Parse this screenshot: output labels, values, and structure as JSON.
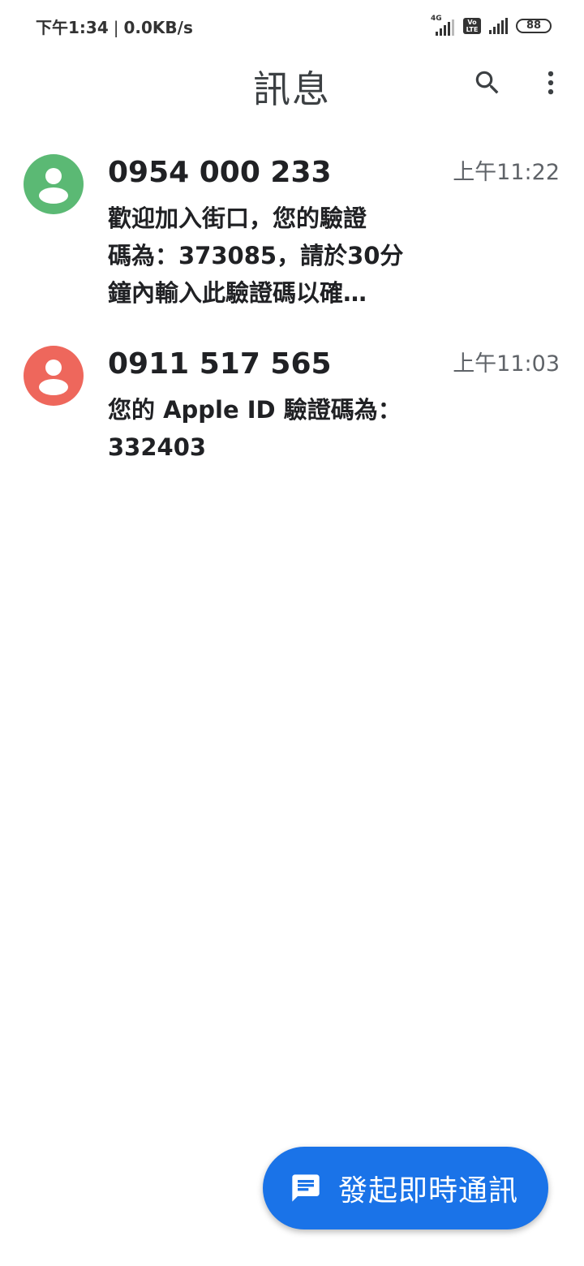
{
  "status_bar": {
    "time": "下午1:34",
    "network_speed": "0.0KB/s",
    "network_type": "4G",
    "volte": "Vo LTE",
    "battery": "88"
  },
  "app_bar": {
    "title": "訊息",
    "search_icon": "search-icon",
    "more_icon": "more-vert-icon"
  },
  "conversations": [
    {
      "sender": "0954 000 233",
      "time": "上午11:22",
      "avatar_color": "#5bb974",
      "snippet_lines": [
        "歡迎加入街口，您的驗證",
        "碼為：373085，請於30分",
        "鐘內輸入此驗證碼以確…"
      ]
    },
    {
      "sender": "0911 517 565",
      "time": "上午11:03",
      "avatar_color": "#ee675c",
      "snippet_lines": [
        "您的 Apple ID 驗證碼為：",
        "332403"
      ]
    }
  ],
  "fab": {
    "label": "發起即時通訊",
    "icon": "chat-icon",
    "color": "#1a73e8"
  }
}
